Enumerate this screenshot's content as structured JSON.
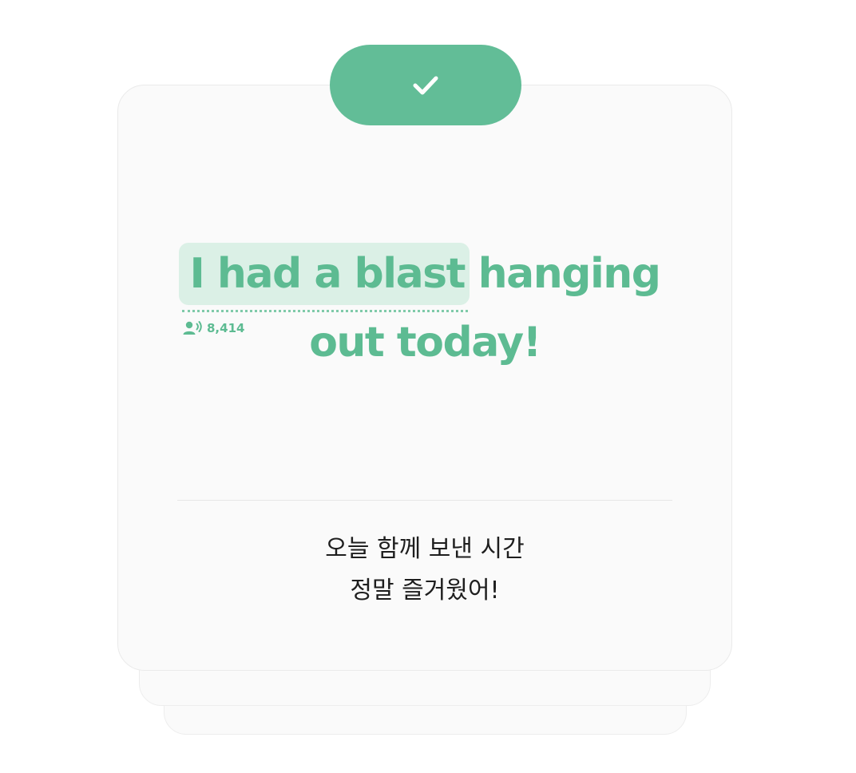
{
  "check_button": {
    "icon": "checkmark-icon",
    "color": "#62bd97"
  },
  "sentence": {
    "highlighted_phrase": "I had a blast",
    "rest_line1": " hanging",
    "line2": "out today!",
    "text_color": "#5dbb92",
    "highlight_color": "#dbf0e6"
  },
  "phrase_stats": {
    "icon": "speaker-person-icon",
    "count": "8,414"
  },
  "translation": {
    "line1": "오늘 함께 보낸 시간",
    "line2": "정말 즐거웠어!"
  }
}
